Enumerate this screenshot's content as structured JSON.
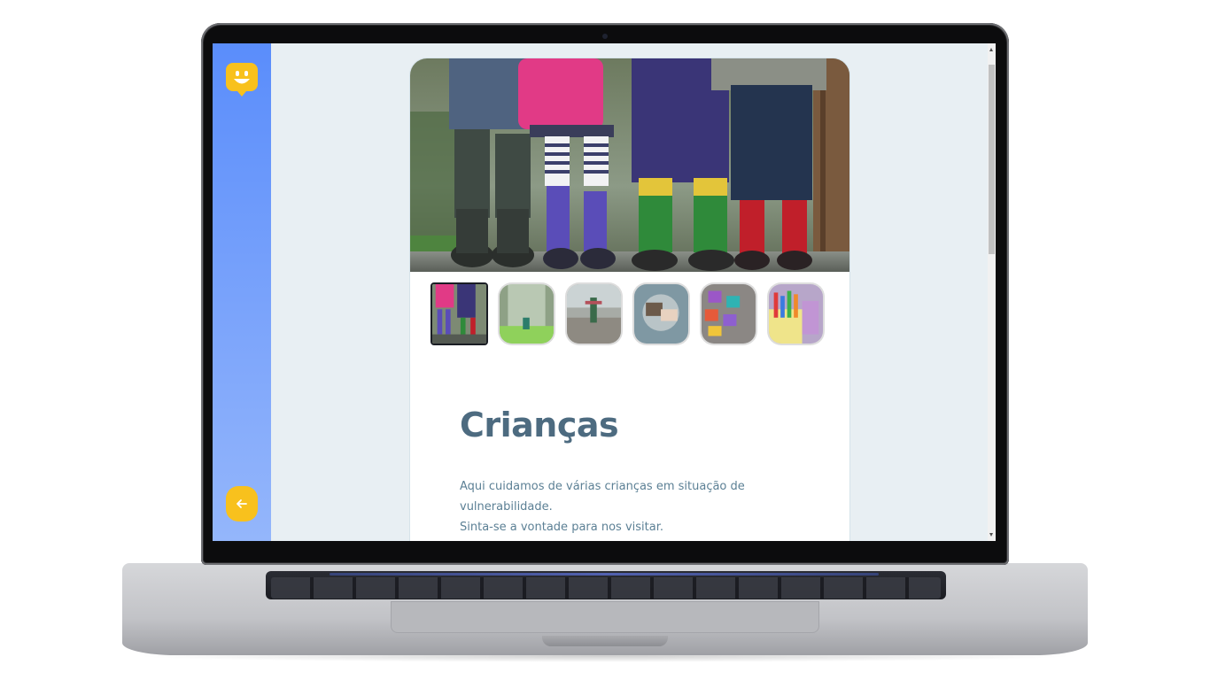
{
  "page": {
    "title": "Crianças",
    "description_lines": [
      "Aqui cuidamos de várias crianças em situação de vulnerabilidade.",
      "Sinta-se a vontade para nos visitar."
    ]
  },
  "sidebar": {
    "logo_icon": "smiley-map-pin-icon",
    "back_icon": "arrow-left-icon"
  },
  "gallery": {
    "main_image": "children-rain-boots-photo",
    "thumbnails": [
      {
        "name": "children-rain-boots-thumb",
        "active": true
      },
      {
        "name": "child-misty-forest-thumb",
        "active": false
      },
      {
        "name": "child-dancing-road-thumb",
        "active": false
      },
      {
        "name": "hands-holding-thumb",
        "active": false
      },
      {
        "name": "alphabet-letters-thumb",
        "active": false
      },
      {
        "name": "crayons-thumb",
        "active": false
      }
    ]
  },
  "colors": {
    "sidebar_top": "#5a8dfb",
    "sidebar_bottom": "#94b6fb",
    "accent_yellow": "#f8c11d",
    "title": "#4d6b80",
    "text": "#5c8095",
    "background": "#e8eff3"
  }
}
